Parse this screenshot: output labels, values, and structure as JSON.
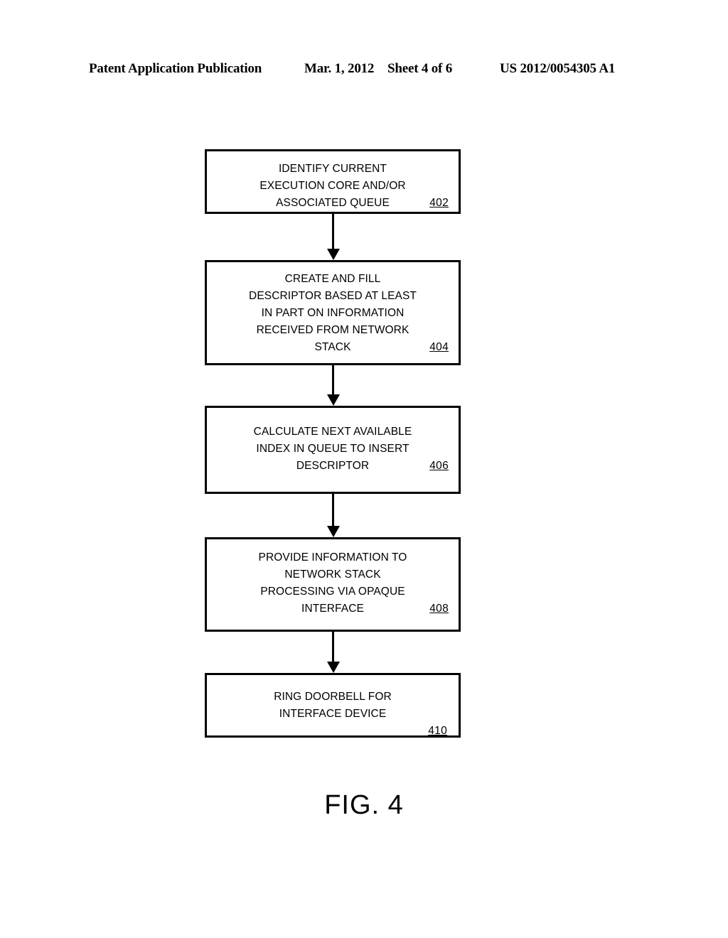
{
  "header": {
    "publication": "Patent Application Publication",
    "date": "Mar. 1, 2012",
    "sheet": "Sheet 4 of 6",
    "pub_number": "US 2012/0054305 A1"
  },
  "figure": {
    "caption": "FIG. 4",
    "type": "flowchart"
  },
  "flowchart": {
    "nodes": [
      {
        "ref": "402",
        "ref_inline": true,
        "lines": [
          "IDENTIFY CURRENT",
          "EXECUTION CORE AND/OR",
          "ASSOCIATED QUEUE"
        ]
      },
      {
        "ref": "404",
        "ref_inline": true,
        "lines": [
          "CREATE AND FILL",
          "DESCRIPTOR BASED AT LEAST",
          "IN PART ON INFORMATION",
          "RECEIVED FROM NETWORK",
          "STACK"
        ]
      },
      {
        "ref": "406",
        "ref_inline": true,
        "lines": [
          "CALCULATE NEXT AVAILABLE",
          "INDEX IN QUEUE TO INSERT",
          "DESCRIPTOR"
        ]
      },
      {
        "ref": "408",
        "ref_inline": true,
        "lines": [
          "PROVIDE INFORMATION TO",
          "NETWORK STACK",
          "PROCESSING VIA OPAQUE",
          "INTERFACE"
        ]
      },
      {
        "ref": "410",
        "ref_inline": false,
        "lines": [
          "RING DOORBELL FOR",
          "INTERFACE DEVICE"
        ]
      }
    ],
    "connectors": [
      {
        "from": "402",
        "to": "404",
        "style": "arrow-down"
      },
      {
        "from": "404",
        "to": "406",
        "style": "arrow-down"
      },
      {
        "from": "406",
        "to": "408",
        "style": "arrow-down"
      },
      {
        "from": "408",
        "to": "410",
        "style": "arrow-down"
      }
    ]
  },
  "colors": {
    "ink": "#000000",
    "paper": "#ffffff"
  }
}
